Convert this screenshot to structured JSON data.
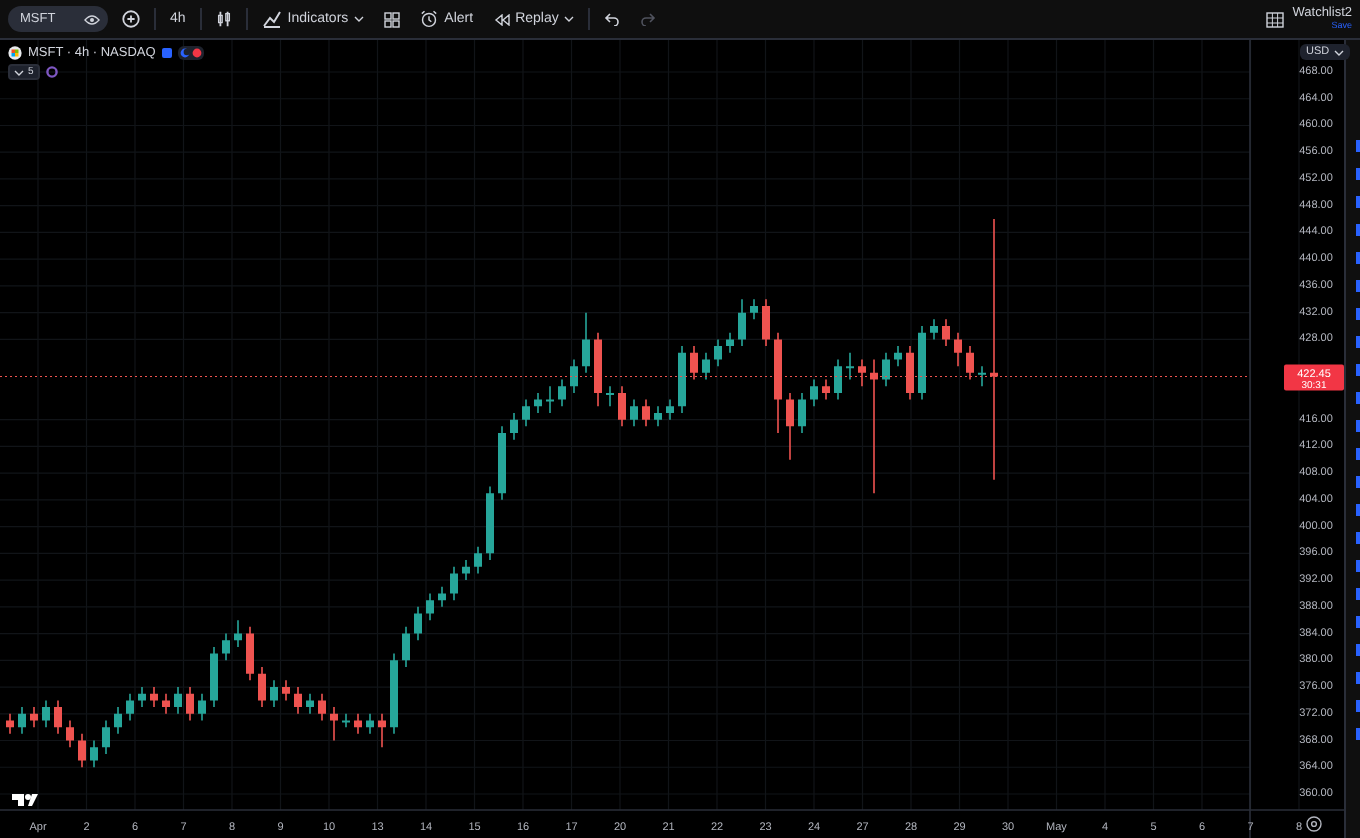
{
  "toolbar": {
    "symbol": {
      "value": "MSFT"
    },
    "items": [
      {
        "kind": "add",
        "disabled": false
      },
      {
        "kind": "interval",
        "label": "4h",
        "disabled": false
      },
      {
        "kind": "chart-type",
        "disabled": false
      },
      {
        "kind": "indicators",
        "label": "Indicators",
        "disabled": false
      },
      {
        "kind": "templates",
        "disabled": false
      },
      {
        "kind": "alert",
        "label": "Alert",
        "disabled": false
      },
      {
        "kind": "replay",
        "label": "Replay",
        "disabled": false
      },
      {
        "kind": "undo",
        "disabled": false
      },
      {
        "kind": "redo",
        "disabled": true
      }
    ],
    "watchlist": {
      "title": "Watchlist2",
      "subtitle": "Save"
    }
  },
  "legend": {
    "title": "MSFT · 4h · NASDAQ",
    "collapse_count": "5"
  },
  "price_axis": {
    "currency": "USD",
    "last_price": "422.45",
    "countdown": "30:31"
  },
  "time_axis": {
    "labels": [
      "Apr",
      "2",
      "6",
      "7",
      "8",
      "9",
      "10",
      "13",
      "14",
      "15",
      "16",
      "17",
      "20",
      "21",
      "22",
      "23",
      "24",
      "27",
      "28",
      "29",
      "30",
      "May",
      "4",
      "5",
      "6",
      "7",
      "8"
    ]
  },
  "chart_data": {
    "type": "candlestick",
    "ylim": [
      360,
      468
    ],
    "yticks": [
      {
        "value": 360,
        "label": "360.00"
      },
      {
        "value": 364,
        "label": "364.00"
      },
      {
        "value": 368,
        "label": "368.00"
      },
      {
        "value": 372,
        "label": "372.00"
      },
      {
        "value": 376,
        "label": "376.00"
      },
      {
        "value": 380,
        "label": "380.00"
      },
      {
        "value": 384,
        "label": "384.00"
      },
      {
        "value": 388,
        "label": "388.00"
      },
      {
        "value": 392,
        "label": "392.00"
      },
      {
        "value": 396,
        "label": "396.00"
      },
      {
        "value": 400,
        "label": "400.00"
      },
      {
        "value": 404,
        "label": "404.00"
      },
      {
        "value": 408,
        "label": "408.00"
      },
      {
        "value": 412,
        "label": "412.00"
      },
      {
        "value": 416,
        "label": "416.00"
      },
      {
        "value": 428,
        "label": "428.00"
      },
      {
        "value": 432,
        "label": "432.00"
      },
      {
        "value": 436,
        "label": "436.00"
      },
      {
        "value": 440,
        "label": "440.00"
      },
      {
        "value": 444,
        "label": "444.00"
      },
      {
        "value": 448,
        "label": "448.00"
      },
      {
        "value": 452,
        "label": "452.00"
      },
      {
        "value": 456,
        "label": "456.00"
      },
      {
        "value": 460,
        "label": "460.00"
      },
      {
        "value": 464,
        "label": "464.00"
      },
      {
        "value": 468,
        "label": "468.00"
      }
    ],
    "categories": [
      null,
      null,
      null,
      null,
      null,
      null,
      null,
      null,
      null,
      null,
      null,
      null,
      null,
      null,
      null,
      null,
      null,
      null,
      null,
      null,
      null,
      null,
      null,
      null,
      null,
      null,
      null,
      null,
      null,
      null,
      null,
      null,
      null,
      null,
      null,
      null,
      null,
      null,
      null,
      null,
      null,
      null,
      null,
      null,
      null,
      null,
      null,
      null,
      null,
      null,
      null,
      null,
      null,
      null,
      null,
      null,
      null,
      null,
      null,
      null,
      null,
      null,
      null,
      null,
      null,
      null,
      null,
      null,
      null,
      null,
      null,
      null,
      null,
      null,
      null,
      null,
      null,
      null,
      null,
      null,
      null,
      null,
      null,
      null,
      null,
      null,
      null,
      null,
      null,
      null,
      null,
      null,
      null,
      null,
      null,
      null,
      null,
      null,
      null,
      null,
      null,
      null,
      null
    ],
    "ohlc": [
      [
        371,
        372,
        369,
        370
      ],
      [
        370,
        373,
        369,
        372
      ],
      [
        372,
        373,
        370,
        371
      ],
      [
        371,
        374,
        370,
        373
      ],
      [
        373,
        374,
        369,
        370
      ],
      [
        370,
        371,
        367,
        368
      ],
      [
        368,
        369,
        364,
        365
      ],
      [
        365,
        368,
        364,
        367
      ],
      [
        367,
        371,
        366,
        370
      ],
      [
        370,
        373,
        369,
        372
      ],
      [
        372,
        375,
        371,
        374
      ],
      [
        374,
        376,
        373,
        375
      ],
      [
        375,
        376,
        373,
        374
      ],
      [
        374,
        375,
        372,
        373
      ],
      [
        373,
        376,
        372,
        375
      ],
      [
        375,
        376,
        371,
        372
      ],
      [
        372,
        375,
        371,
        374
      ],
      [
        374,
        382,
        373,
        381
      ],
      [
        381,
        384,
        380,
        383
      ],
      [
        383,
        386,
        382,
        384
      ],
      [
        384,
        385,
        377,
        378
      ],
      [
        378,
        379,
        373,
        374
      ],
      [
        374,
        377,
        373,
        376
      ],
      [
        376,
        377,
        374,
        375
      ],
      [
        375,
        376,
        372,
        373
      ],
      [
        373,
        375,
        372,
        374
      ],
      [
        374,
        375,
        371,
        372
      ],
      [
        372,
        373,
        368,
        371
      ],
      [
        371,
        372,
        370,
        371
      ],
      [
        371,
        372,
        369,
        370
      ],
      [
        370,
        372,
        369,
        371
      ],
      [
        371,
        372,
        367,
        370
      ],
      [
        370,
        381,
        369,
        380
      ],
      [
        380,
        385,
        379,
        384
      ],
      [
        384,
        388,
        383,
        387
      ],
      [
        387,
        390,
        386,
        389
      ],
      [
        389,
        391,
        388,
        390
      ],
      [
        390,
        394,
        389,
        393
      ],
      [
        393,
        395,
        392,
        394
      ],
      [
        394,
        397,
        393,
        396
      ],
      [
        396,
        406,
        395,
        405
      ],
      [
        405,
        415,
        404,
        414
      ],
      [
        414,
        417,
        413,
        416
      ],
      [
        416,
        419,
        415,
        418
      ],
      [
        418,
        420,
        417,
        419
      ],
      [
        419,
        421,
        417,
        419
      ],
      [
        419,
        422,
        418,
        421
      ],
      [
        421,
        425,
        420,
        424
      ],
      [
        424,
        432,
        423,
        428
      ],
      [
        428,
        429,
        418,
        420
      ],
      [
        420,
        421,
        418,
        420
      ],
      [
        420,
        421,
        415,
        416
      ],
      [
        416,
        419,
        415,
        418
      ],
      [
        418,
        419,
        415,
        416
      ],
      [
        416,
        418,
        415,
        417
      ],
      [
        417,
        419,
        416,
        418
      ],
      [
        418,
        427,
        417,
        426
      ],
      [
        426,
        427,
        422,
        423
      ],
      [
        423,
        426,
        422,
        425
      ],
      [
        425,
        428,
        424,
        427
      ],
      [
        427,
        429,
        426,
        428
      ],
      [
        428,
        434,
        427,
        432
      ],
      [
        432,
        434,
        431,
        433
      ],
      [
        433,
        434,
        427,
        428
      ],
      [
        428,
        429,
        414,
        419
      ],
      [
        419,
        420,
        410,
        415
      ],
      [
        415,
        420,
        414,
        419
      ],
      [
        419,
        422,
        418,
        421
      ],
      [
        421,
        422,
        419,
        420
      ],
      [
        420,
        425,
        419,
        424
      ],
      [
        424,
        426,
        422,
        424
      ],
      [
        424,
        425,
        421,
        423
      ],
      [
        423,
        425,
        405,
        422
      ],
      [
        422,
        426,
        421,
        425
      ],
      [
        425,
        427,
        424,
        426
      ],
      [
        426,
        427,
        419,
        420
      ],
      [
        420,
        430,
        419,
        429
      ],
      [
        429,
        431,
        428,
        430
      ],
      [
        430,
        431,
        427,
        428
      ],
      [
        428,
        429,
        424,
        426
      ],
      [
        426,
        427,
        422,
        423
      ],
      [
        423,
        424,
        421,
        423
      ],
      [
        423,
        446,
        407,
        422.45
      ],
      null,
      null,
      null,
      null,
      null,
      null,
      null,
      null,
      null,
      null,
      null,
      null,
      null,
      null,
      null,
      null,
      null,
      null,
      null,
      null
    ]
  }
}
